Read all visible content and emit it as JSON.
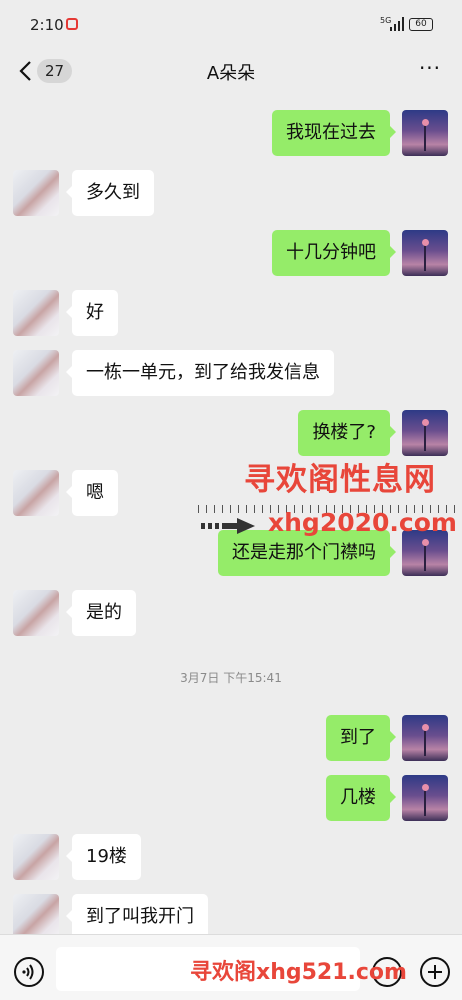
{
  "status_bar": {
    "time": "2:10",
    "signal": "5G",
    "battery": "60"
  },
  "header": {
    "back_badge": "27",
    "title": "A朵朵",
    "more_label": "···"
  },
  "messages": [
    {
      "side": "right",
      "text": "我现在过去"
    },
    {
      "side": "left",
      "text": "多久到"
    },
    {
      "side": "right",
      "text": "十几分钟吧"
    },
    {
      "side": "left",
      "text": "好"
    },
    {
      "side": "left",
      "text": "一栋一单元，到了给我发信息"
    },
    {
      "side": "right",
      "text": "换楼了?"
    },
    {
      "side": "left",
      "text": "嗯"
    },
    {
      "side": "right",
      "text": "还是走那个门襟吗"
    },
    {
      "side": "left",
      "text": "是的"
    },
    {
      "side": "right",
      "text": "到了"
    },
    {
      "side": "right",
      "text": "几楼"
    },
    {
      "side": "left",
      "text": "19楼"
    },
    {
      "side": "left",
      "text": "到了叫我开门"
    }
  ],
  "timestamp": "3月7日 下午15:41",
  "watermarks": {
    "line1": "寻欢阁性息网",
    "line2": "xhg2020.com",
    "bottom": "寻欢阁xhg521.com"
  },
  "colors": {
    "background": "#ededed",
    "sent_bubble": "#95ec69",
    "received_bubble": "#ffffff",
    "watermark": "#e8463a"
  }
}
